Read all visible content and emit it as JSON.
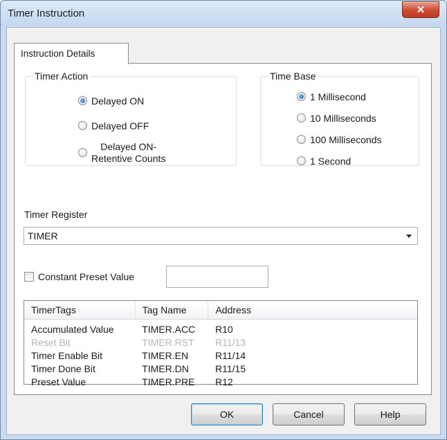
{
  "window": {
    "title": "Timer Instruction",
    "close_glyph": "✕"
  },
  "tabs": [
    {
      "label": "Instruction Details"
    }
  ],
  "timer_action": {
    "legend": "Timer Action",
    "options": [
      {
        "label": "Delayed ON",
        "checked": true
      },
      {
        "label": "Delayed OFF",
        "checked": false
      },
      {
        "label": "Delayed ON-\nRetentive Counts",
        "checked": false
      }
    ]
  },
  "time_base": {
    "legend": "Time Base",
    "options": [
      {
        "label": "1 Millisecond",
        "checked": true
      },
      {
        "label": "10 Milliseconds",
        "checked": false
      },
      {
        "label": "100 Milliseconds",
        "checked": false
      },
      {
        "label": "1 Second",
        "checked": false
      }
    ]
  },
  "timer_register": {
    "label": "Timer Register",
    "value": "TIMER"
  },
  "constant_preset": {
    "label": "Constant Preset Value",
    "checked": false,
    "value": ""
  },
  "table": {
    "columns": [
      "TimerTags",
      "Tag Name",
      "Address"
    ],
    "rows": [
      {
        "tag": "Accumulated Value",
        "name": "TIMER.ACC",
        "address": "R10",
        "disabled": false
      },
      {
        "tag": "Reset Bit",
        "name": "TIMER.RST",
        "address": "R11/13",
        "disabled": true
      },
      {
        "tag": "Timer Enable Bit",
        "name": "TIMER.EN",
        "address": "R11/14",
        "disabled": false
      },
      {
        "tag": "Timer Done Bit",
        "name": "TIMER.DN",
        "address": "R11/15",
        "disabled": false
      },
      {
        "tag": "Preset Value",
        "name": "TIMER.PRE",
        "address": "R12",
        "disabled": false
      }
    ]
  },
  "buttons": {
    "ok": "OK",
    "cancel": "Cancel",
    "help": "Help"
  },
  "colors": {
    "title_bar": "#c7daf0",
    "close_button": "#c94a32",
    "radio_selected": "#1f5fb5",
    "disabled_text": "#b5b5b5"
  }
}
